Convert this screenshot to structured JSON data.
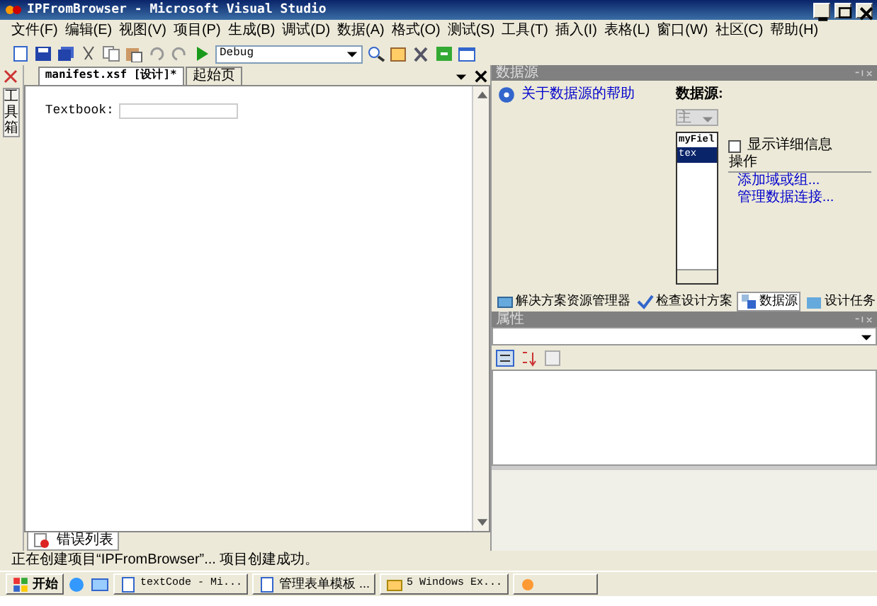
{
  "window": {
    "title": "IPFromBrowser - Microsoft Visual Studio"
  },
  "menu": [
    "文件(F)",
    "编辑(E)",
    "视图(V)",
    "项目(P)",
    "生成(B)",
    "调试(D)",
    "数据(A)",
    "格式(O)",
    "测试(S)",
    "工具(T)",
    "插入(I)",
    "表格(L)",
    "窗口(W)",
    "社区(C)",
    "帮助(H)"
  ],
  "toolbar": {
    "configuration": "Debug"
  },
  "toolbox_tab": "工具箱",
  "document": {
    "tabs": [
      {
        "label": "manifest.xsf [设计]*",
        "selected": true
      },
      {
        "label": "起始页",
        "selected": false
      }
    ],
    "field_label": "Textbook:",
    "bottom_tab": "错误列表"
  },
  "data_source": {
    "title": "数据源",
    "help_link": "关于数据源的帮助",
    "source_label": "数据源:",
    "source_value": "主",
    "tree": [
      {
        "label": "myFiel",
        "kind": "group",
        "selected": false
      },
      {
        "label": "tex",
        "kind": "field",
        "selected": true
      }
    ],
    "show_details": {
      "label": "显示详细信息",
      "checked": false
    },
    "actions_heading": "操作",
    "actions": [
      "添加域或组...",
      "管理数据连接..."
    ]
  },
  "panel_tabs": [
    {
      "label": "解决方案资源管理器",
      "selected": false
    },
    {
      "label": "检查设计方案",
      "selected": false
    },
    {
      "label": "数据源",
      "selected": true
    },
    {
      "label": "设计任务",
      "selected": false
    }
  ],
  "properties": {
    "title": "属性"
  },
  "status_bar": "正在创建项目“IPFromBrowser”... 项目创建成功。",
  "taskbar": {
    "start": "开始",
    "items": [
      {
        "label": "textCode - Mi..."
      },
      {
        "label": "管理表单模板 ..."
      },
      {
        "label": "5 Windows Ex..."
      }
    ]
  }
}
